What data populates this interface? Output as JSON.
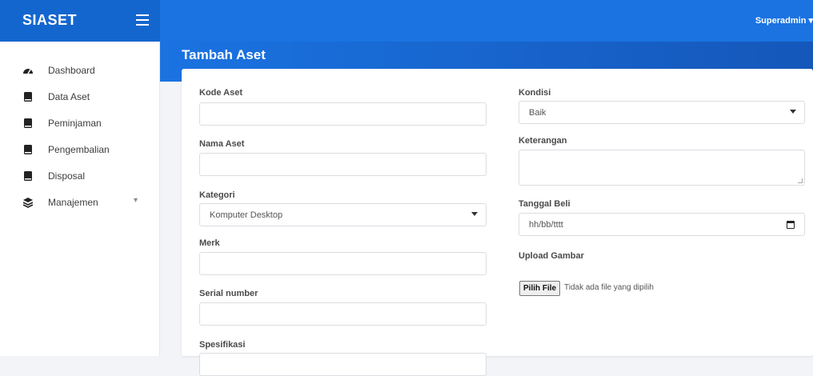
{
  "app": {
    "brand": "SIASET",
    "user_menu": "Superadmin ▾"
  },
  "sidebar": {
    "items": [
      {
        "label": "Dashboard",
        "icon": "dashboard-gauge-icon"
      },
      {
        "label": "Data Aset",
        "icon": "book-icon"
      },
      {
        "label": "Peminjaman",
        "icon": "book-icon"
      },
      {
        "label": "Pengembalian",
        "icon": "book-icon"
      },
      {
        "label": "Disposal",
        "icon": "book-icon"
      },
      {
        "label": "Manajemen",
        "icon": "layers-icon",
        "has_submenu": true
      }
    ]
  },
  "page": {
    "title": "Tambah Aset"
  },
  "form": {
    "kode_aset": {
      "label": "Kode Aset",
      "value": ""
    },
    "nama_aset": {
      "label": "Nama Aset",
      "value": ""
    },
    "kategori": {
      "label": "Kategori",
      "value": "Komputer Desktop"
    },
    "merk": {
      "label": "Merk",
      "value": ""
    },
    "serial_number": {
      "label": "Serial number",
      "value": ""
    },
    "spesifikasi": {
      "label": "Spesifikasi",
      "value": ""
    },
    "kondisi": {
      "label": "Kondisi",
      "value": "Baik"
    },
    "keterangan": {
      "label": "Keterangan",
      "value": ""
    },
    "tanggal_beli": {
      "label": "Tanggal Beli",
      "placeholder": "hh/bb/tttt"
    },
    "upload_gambar": {
      "label": "Upload Gambar",
      "button": "Pilih File",
      "status": "Tidak ada file yang dipilih"
    }
  },
  "colors": {
    "primary": "#1a73e1",
    "brand_bg": "#1466cf"
  }
}
